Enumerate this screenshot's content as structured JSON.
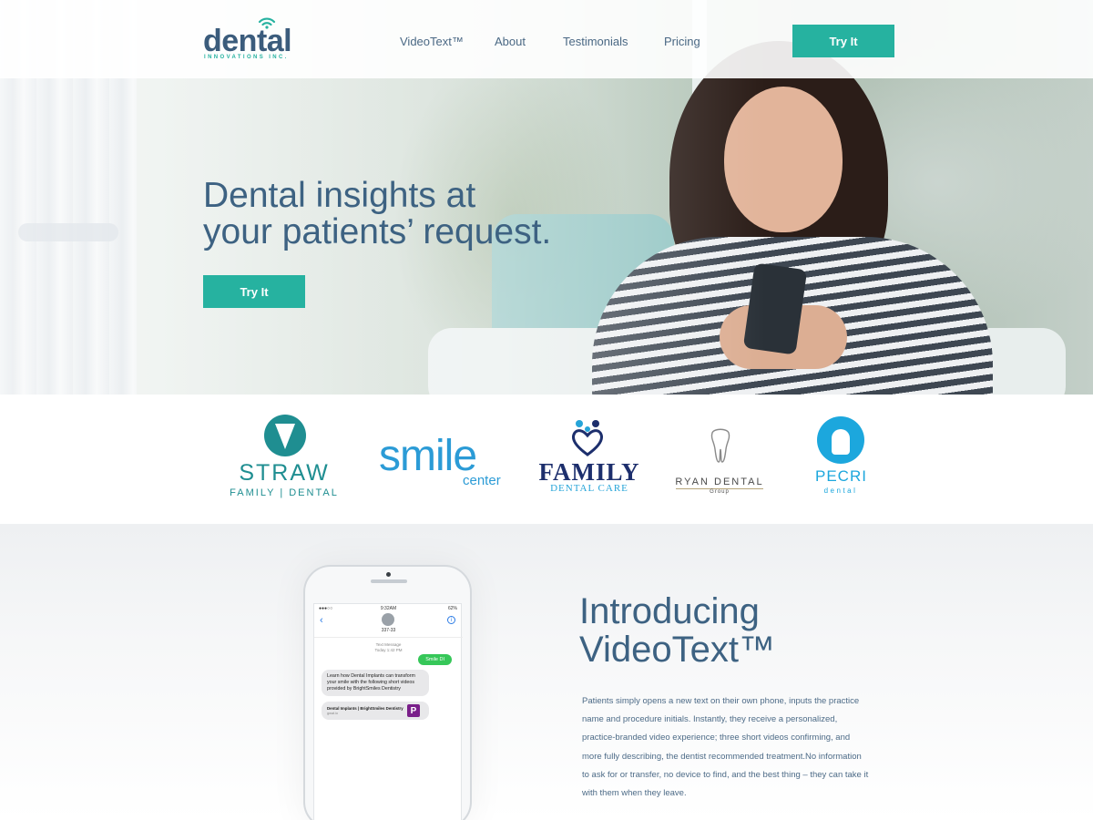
{
  "header": {
    "logo": {
      "word": "dental",
      "sub": "INNOVATIONS INC."
    },
    "nav": [
      "VideoText™",
      "About",
      "Testimonials",
      "Pricing"
    ],
    "cta": "Try It"
  },
  "hero": {
    "title_line1": "Dental insights at",
    "title_line2": "your patients’ request.",
    "cta": "Try It"
  },
  "clients": {
    "straw": {
      "name": "STRAW",
      "sub": "FAMILY | DENTAL"
    },
    "smile": {
      "name": "smile",
      "sub": "center"
    },
    "family": {
      "name": "FAMILY",
      "sub": "DENTAL CARE"
    },
    "ryan": {
      "name": "RYAN DENTAL",
      "sub": "Group"
    },
    "pecri": {
      "name": "PECRI",
      "sub": "dental"
    }
  },
  "feature": {
    "title_line1": "Introducing",
    "title_line2": "VideoText™",
    "body": "Patients simply opens a new text on their own phone, inputs the practice name and procedure initials.  Instantly, they receive a personalized, practice-branded video experience; three short videos confirming, and more fully describing, the dentist recommended treatment.No information to ask for or transfer, no device to find, and the best thing – they can take it with them when they leave."
  },
  "phone": {
    "status_time": "9:32AM",
    "status_battery": "62%",
    "status_signal": "●●●○○",
    "contact": "337-33",
    "meta_line1": "Text Message",
    "meta_line2": "Today 1:42 PM",
    "outgoing": "Smile DI",
    "incoming": "Learn how Dental Implants can transform your smile with the following short videos provided by BrightSmiles Dentistry",
    "link_title": "Dental Implants | BrightSmiles Dentistry",
    "link_url": "gwat.io",
    "link_thumb": "P"
  },
  "colors": {
    "accent": "#26b2a0",
    "heading": "#3d6282",
    "navy": "#3b5c7c"
  }
}
